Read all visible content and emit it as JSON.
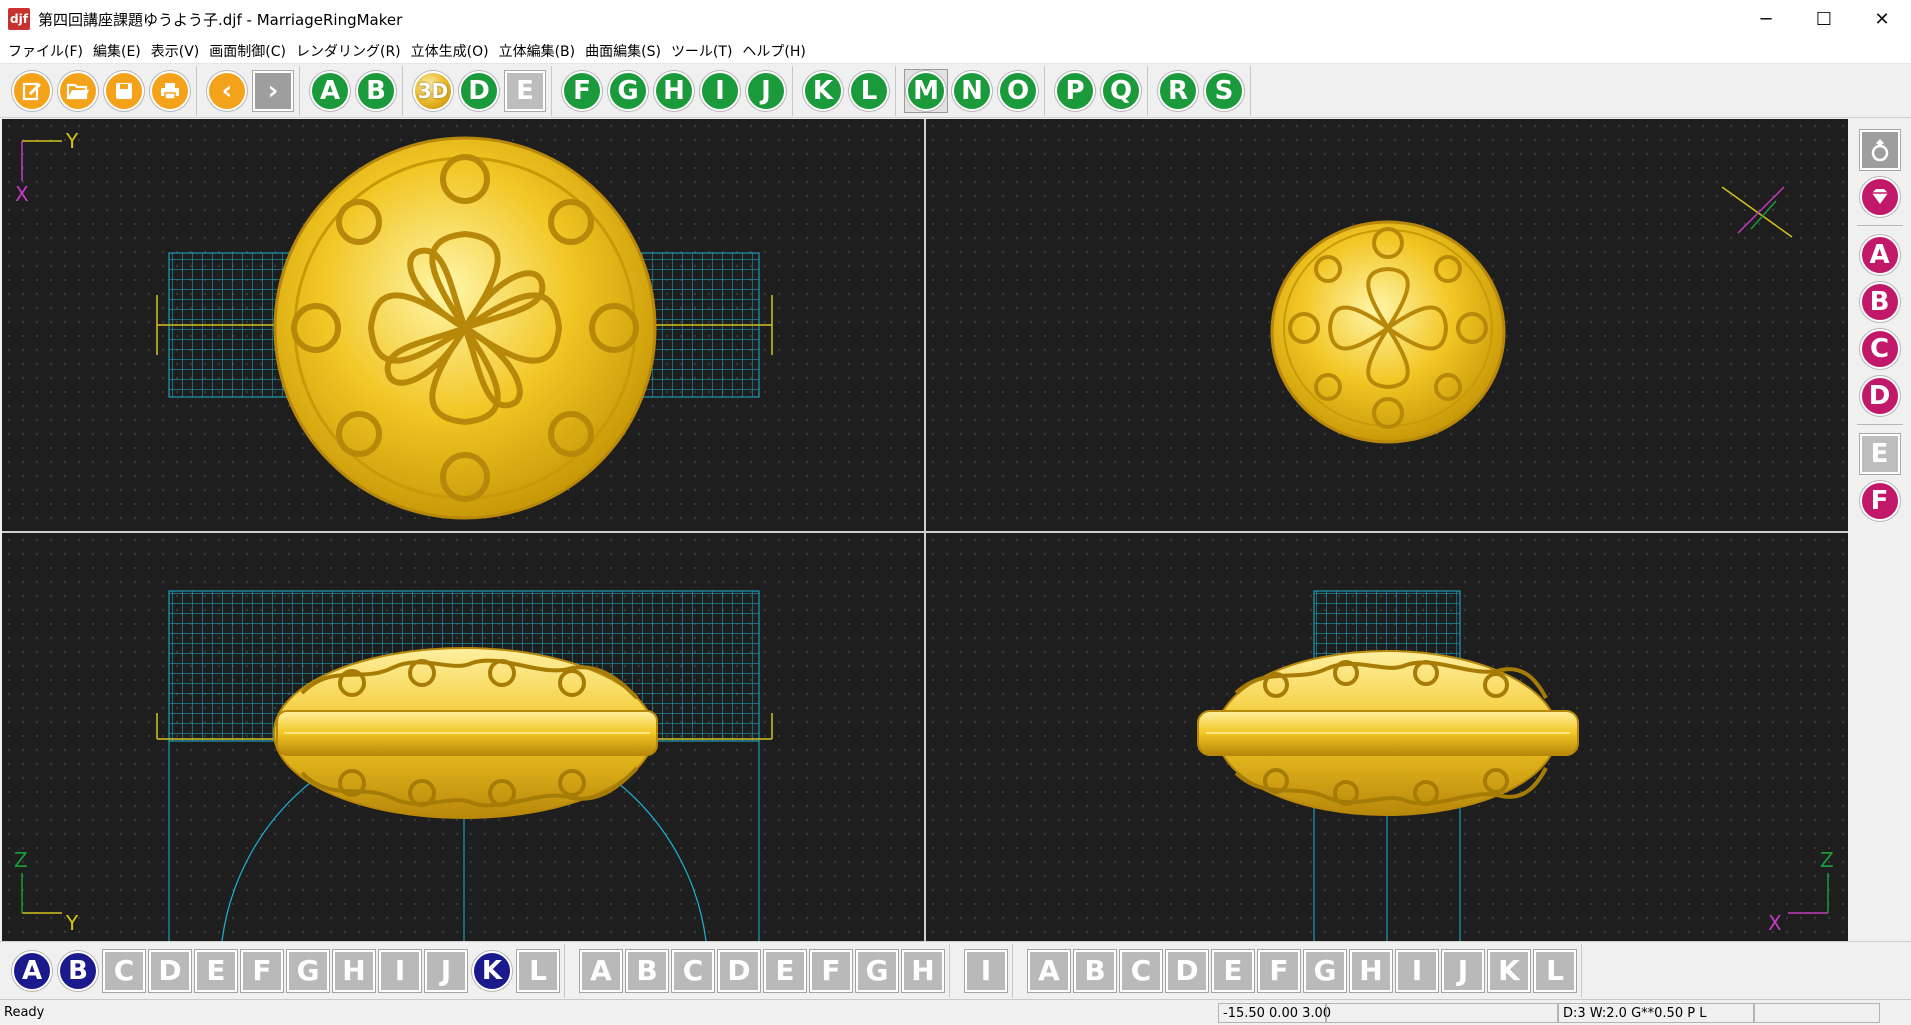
{
  "window": {
    "icon_label": "djf",
    "title": "第四回講座課題ゆうよう子.djf - MarriageRingMaker",
    "minimize": "─",
    "maximize": "☐",
    "close": "✕"
  },
  "menu": [
    "ファイル(F)",
    "編集(E)",
    "表示(V)",
    "画面制御(C)",
    "レンダリング(R)",
    "立体生成(O)",
    "立体編集(B)",
    "曲面編集(S)",
    "ツール(T)",
    "ヘルプ(H)"
  ],
  "toolbar": {
    "file_icons": [
      "new-icon",
      "open-folder-icon",
      "save-icon",
      "print-icon"
    ],
    "nav": [
      "‹",
      "›"
    ],
    "group_ab": [
      "A",
      "B"
    ],
    "group_3d": [
      "3D",
      "D",
      "E"
    ],
    "group_fj": [
      "F",
      "G",
      "H",
      "I",
      "J"
    ],
    "group_kl": [
      "K",
      "L"
    ],
    "group_mo": [
      "M",
      "N",
      "O"
    ],
    "group_pq": [
      "P",
      "Q"
    ],
    "group_rs": [
      "R",
      "S"
    ],
    "active": [
      "M"
    ]
  },
  "viewports": {
    "top_left_axes": {
      "vertical": "Y",
      "horizontal": "X"
    },
    "bottom_left_axes": {
      "vertical": "Z",
      "horizontal": "Y"
    },
    "bottom_right_axes": {
      "vertical": "Z",
      "horizontal": "X"
    }
  },
  "side_panel": {
    "icons": [
      "ring-icon",
      "gem-icon"
    ],
    "letters_top": [
      "A",
      "B",
      "C",
      "D"
    ],
    "letters_bottom_grey": [
      "E"
    ],
    "letters_bottom": [
      "F"
    ]
  },
  "bottom_toolbar": {
    "group1": [
      "A",
      "B",
      "C",
      "D",
      "E",
      "F",
      "G",
      "H",
      "I",
      "J",
      "K",
      "L"
    ],
    "group1_active": [
      "A",
      "B",
      "K"
    ],
    "group2": [
      "A",
      "B",
      "C",
      "D",
      "E",
      "F",
      "G",
      "H"
    ],
    "group3": [
      "I"
    ],
    "group4": [
      "A",
      "B",
      "C",
      "D",
      "E",
      "F",
      "G",
      "H",
      "I",
      "J",
      "K",
      "L"
    ]
  },
  "status": {
    "ready": "Ready",
    "coords": "-15.50 0.00 3.00",
    "info": "D:3 W:2.0  G**0.50 P   L"
  },
  "colors": {
    "orange": "#f5a21b",
    "green": "#1a9a3a",
    "magenta": "#c2186a",
    "navy": "#1a1a8c",
    "grid_cyan": "#1ab4d4",
    "gold": "#e6b422",
    "viewport_bg": "#1e1e1e"
  }
}
